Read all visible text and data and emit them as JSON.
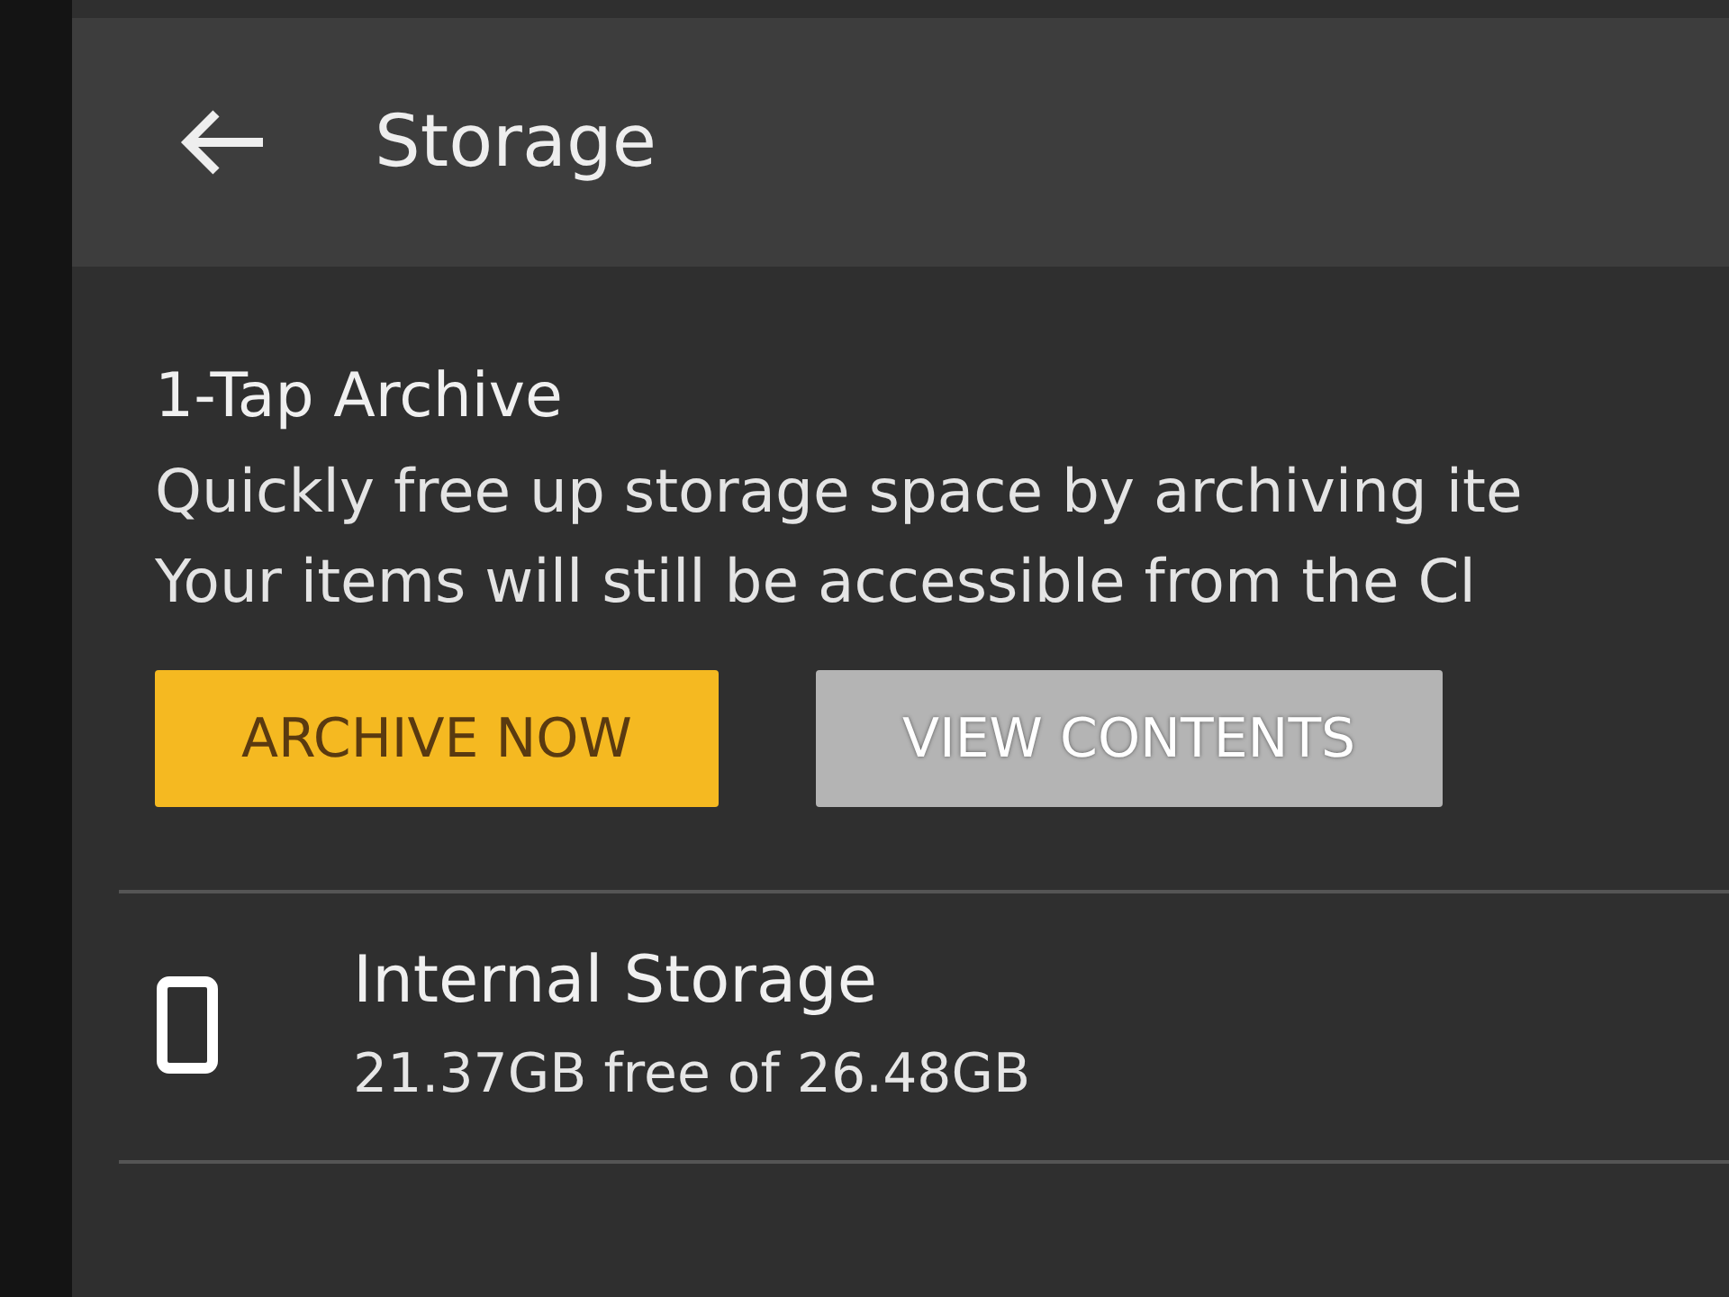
{
  "header": {
    "title": "Storage"
  },
  "archive": {
    "title": "1-Tap Archive",
    "lines": [
      "Quickly free up storage space by archiving ite",
      "Your items will still be accessible from the Cl"
    ],
    "buttons": [
      {
        "label": "ARCHIVE NOW",
        "kind": "primary"
      },
      {
        "label": "VIEW CONTENTS",
        "kind": "secondary"
      }
    ]
  },
  "storage_items": [
    {
      "name": "Internal Storage",
      "detail": "21.37GB free of 26.48GB"
    }
  ]
}
